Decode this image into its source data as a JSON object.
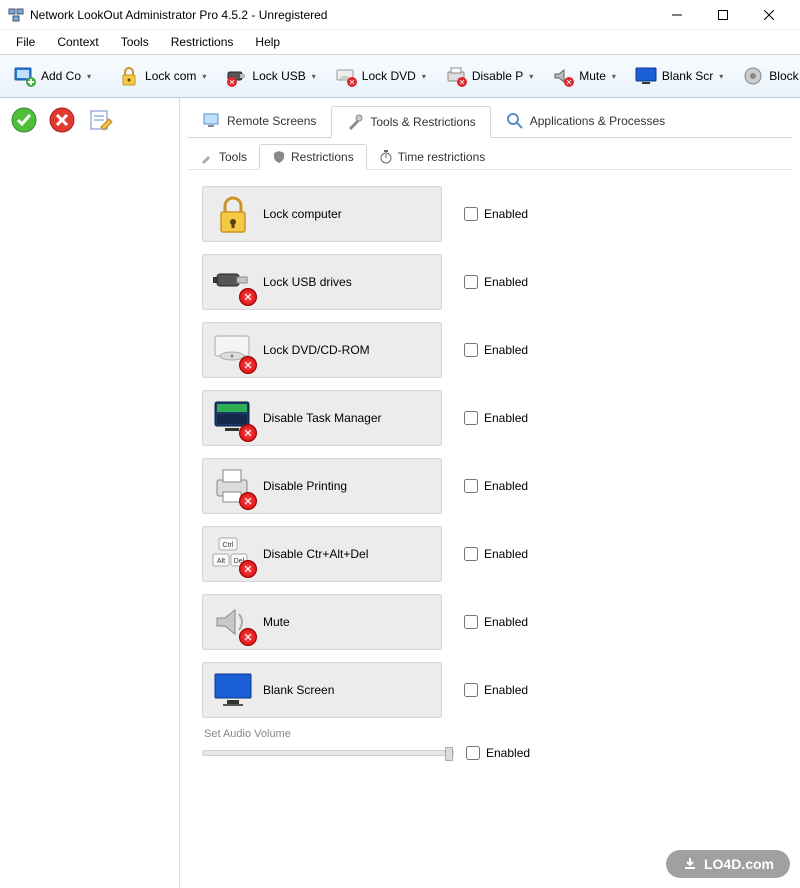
{
  "window": {
    "title": "Network LookOut Administrator Pro 4.5.2 - Unregistered"
  },
  "menubar": [
    "File",
    "Context",
    "Tools",
    "Restrictions",
    "Help"
  ],
  "toolbar": [
    {
      "label": "Add Co",
      "icon": "add-computer"
    },
    {
      "label": "Lock com",
      "icon": "lock"
    },
    {
      "label": "Lock USB",
      "icon": "usb-lock"
    },
    {
      "label": "Lock DVD",
      "icon": "dvd-lock"
    },
    {
      "label": "Disable P",
      "icon": "printer-disable"
    },
    {
      "label": "Mute",
      "icon": "mute"
    },
    {
      "label": "Blank Scr",
      "icon": "blank-screen"
    },
    {
      "label": "Block App",
      "icon": "gear-block"
    }
  ],
  "tabs1": [
    {
      "label": "Remote Screens",
      "icon": "monitor",
      "active": false
    },
    {
      "label": "Tools & Restrictions",
      "icon": "tools",
      "active": true
    },
    {
      "label": "Applications & Processes",
      "icon": "search",
      "active": false
    }
  ],
  "tabs2": [
    {
      "label": "Tools",
      "icon": "wrench",
      "active": false
    },
    {
      "label": "Restrictions",
      "icon": "shield",
      "active": true
    },
    {
      "label": "Time restrictions",
      "icon": "stopwatch",
      "active": false
    }
  ],
  "restrictions": [
    {
      "label": "Lock computer",
      "icon": "lock-big",
      "enabled_label": "Enabled"
    },
    {
      "label": "Lock USB drives",
      "icon": "usb-x",
      "enabled_label": "Enabled"
    },
    {
      "label": "Lock DVD/CD-ROM",
      "icon": "dvd-x",
      "enabled_label": "Enabled"
    },
    {
      "label": "Disable Task Manager",
      "icon": "taskmgr-x",
      "enabled_label": "Enabled"
    },
    {
      "label": "Disable Printing",
      "icon": "printer-x",
      "enabled_label": "Enabled"
    },
    {
      "label": "Disable Ctr+Alt+Del",
      "icon": "keys-x",
      "enabled_label": "Enabled"
    },
    {
      "label": "Mute",
      "icon": "speaker-x",
      "enabled_label": "Enabled"
    },
    {
      "label": "Blank Screen",
      "icon": "monitor-blue",
      "enabled_label": "Enabled"
    }
  ],
  "audio": {
    "label": "Set Audio Volume",
    "enabled_label": "Enabled"
  },
  "watermark": "LO4D.com"
}
